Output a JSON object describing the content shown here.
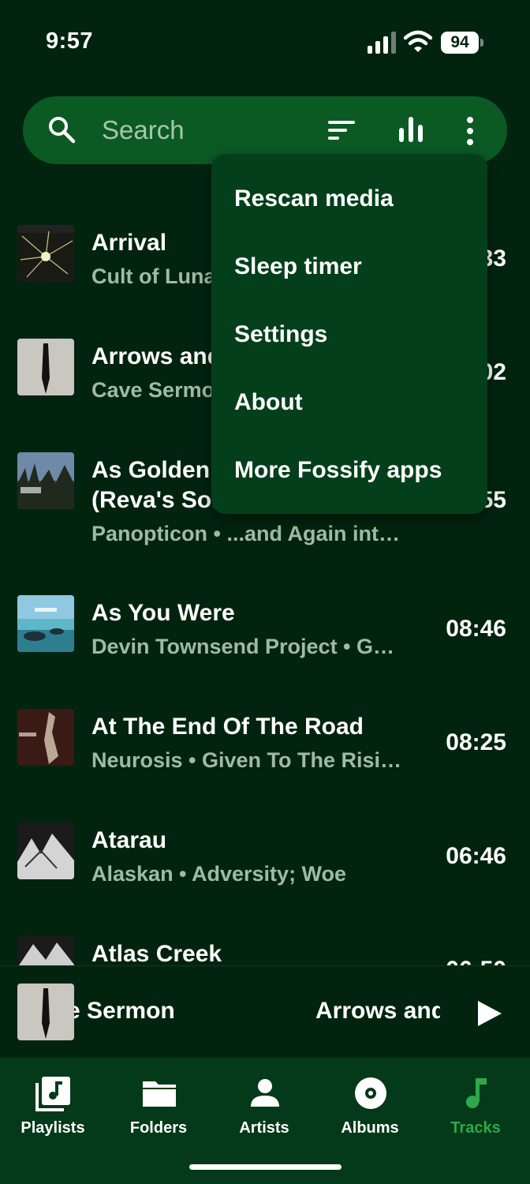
{
  "status_bar": {
    "time": "9:57",
    "battery": "94"
  },
  "search": {
    "placeholder": "Search"
  },
  "tracks": [
    {
      "title": "Arrival",
      "subtitle": "Cult of Luna",
      "duration": "…33"
    },
    {
      "title": "Arrows and",
      "subtitle": "Cave Sermon",
      "duration": "…02"
    },
    {
      "title_line1": "As Golden",
      "title_line2": "(Reva's Song)",
      "subtitle": "Panopticon • ...and Again int…",
      "duration": "…55"
    },
    {
      "title": "As You Were",
      "subtitle": "Devin Townsend Project • Gh…",
      "duration": "08:46"
    },
    {
      "title": "At The End Of The Road",
      "subtitle": "Neurosis • Given To The Risi…",
      "duration": "08:25"
    },
    {
      "title": "Atarau",
      "subtitle": "Alaskan • Adversity; Woe",
      "duration": "06:46"
    },
    {
      "title": "Atlas Creek",
      "subtitle": "",
      "duration": "06:50"
    }
  ],
  "menu": {
    "items": [
      "Rescan media",
      "Sleep timer",
      "Settings",
      "About",
      "More Fossify apps"
    ]
  },
  "now_playing": {
    "artist": "Cave Sermon",
    "title": "Arrows and Fire"
  },
  "nav": {
    "items": [
      {
        "label": "Playlists",
        "icon": "playlist-icon"
      },
      {
        "label": "Folders",
        "icon": "folder-icon"
      },
      {
        "label": "Artists",
        "icon": "person-icon"
      },
      {
        "label": "Albums",
        "icon": "album-icon"
      },
      {
        "label": "Tracks",
        "icon": "music-note-icon",
        "active": true
      }
    ]
  },
  "colors": {
    "background": "#02240f",
    "search_bar": "#0b5a24",
    "menu": "#043f1b",
    "accent": "#2fa84b",
    "nav_bg": "#043a19"
  }
}
